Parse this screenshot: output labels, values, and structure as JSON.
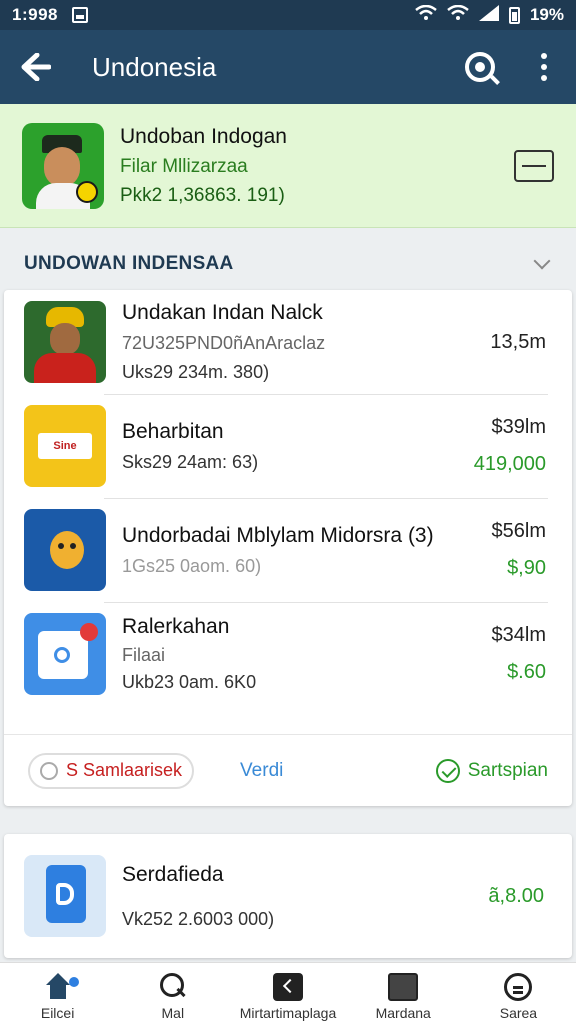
{
  "status_bar": {
    "time": "1:998",
    "battery": "19%"
  },
  "app_bar": {
    "title": "Undonesia"
  },
  "profile": {
    "name": "Undoban Indogan",
    "sub": "Filar Mllizarzaa",
    "id": "Pkk2 1,36863. 191)"
  },
  "section": {
    "title": "UNDOWAN INDENSAA"
  },
  "items": [
    {
      "title": "Undakan Indan Nalck",
      "sub": "72U325PND0ñAnAraclaz",
      "meta": "Uks29 234m. 380)",
      "price": "13,5m",
      "price2": ""
    },
    {
      "title": "Beharbitan",
      "sub": "",
      "meta": "Sks29 24am: 63)",
      "price": "$39lm",
      "price2": "419,000",
      "thumb_text": "Sine"
    },
    {
      "title": "Undorbadai Mblylam Midorsra (3)",
      "sub": "",
      "meta": "1Gs25 0aom. 60)",
      "price": "$56lm",
      "price2": "$,90"
    },
    {
      "title": "Ralerkahan",
      "sub": "Filaai",
      "meta": "Ukb23 0am. 6K0",
      "price": "$34lm",
      "price2": "$.60"
    }
  ],
  "footer": {
    "pill": "S Samlaarisek",
    "link": "Verdi",
    "ok": "Sartspian"
  },
  "card2": {
    "title": "Serdafieda",
    "meta": "Vk252 2.6003 000)",
    "price": "ã,8.00"
  },
  "nav": [
    {
      "label": "Eilcei",
      "icon": "home-icon"
    },
    {
      "label": "Mal",
      "icon": "search-icon"
    },
    {
      "label": "Mirtartimaplaga",
      "icon": "back-icon"
    },
    {
      "label": "Mardana",
      "icon": "tv-icon"
    },
    {
      "label": "Sarea",
      "icon": "bot-icon"
    }
  ]
}
